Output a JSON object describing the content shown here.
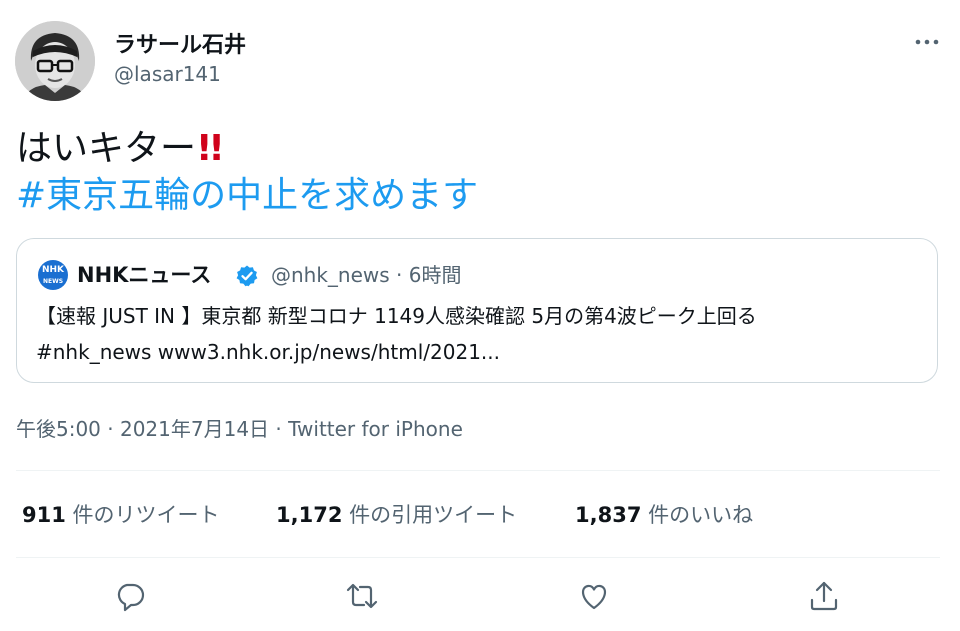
{
  "author": {
    "display_name": "ラサール石井",
    "handle": "@lasar141"
  },
  "tweet": {
    "text": "はいキター",
    "emphasis": "!!",
    "hashtag": "#東京五輪の中止を求めます"
  },
  "quoted_tweet": {
    "logo_line1": "NHK",
    "logo_line2": "NEWS",
    "display_name": "NHKニュース",
    "meta": "@nhk_news · 6時間",
    "text_line1": "【速報 JUST IN 】東京都 新型コロナ 1149人感染確認 5月の第4波ピーク上回る",
    "text_line2": "#nhk_news www3.nhk.or.jp/news/html/2021..."
  },
  "timestamp": "午後5:00 · 2021年7月14日 · Twitter for iPhone",
  "stats": {
    "retweets_count": "911",
    "retweets_label": " 件のリツイート",
    "quotes_count": "1,172",
    "quotes_label": " 件の引用ツイート",
    "likes_count": "1,837",
    "likes_label": " 件のいいね"
  },
  "colors": {
    "link": "#1d9bf0",
    "secondary_text": "#536471",
    "emphasis": "#d0021b",
    "verified": "#1d9bf0"
  },
  "icons": [
    "more-icon",
    "verified-icon",
    "reply-icon",
    "retweet-icon",
    "like-icon",
    "share-icon"
  ]
}
